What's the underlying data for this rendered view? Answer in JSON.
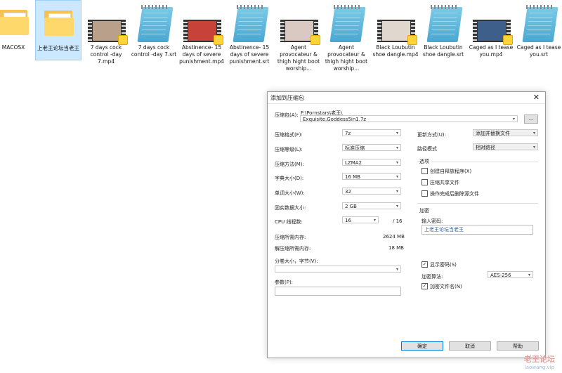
{
  "desktop": {
    "files": [
      {
        "name": "MACOSX",
        "kind": "folder"
      },
      {
        "name": "上老王论坛当老王",
        "kind": "folder",
        "selected": true
      },
      {
        "name": "7 days cock control -day 7.mp4",
        "kind": "video",
        "thumb": "#b9a08a"
      },
      {
        "name": "7 days cock control -day 7.srt",
        "kind": "notepad"
      },
      {
        "name": "Abstinence- 15 days of severe punishment.mp4",
        "kind": "video",
        "thumb": "#c7433a"
      },
      {
        "name": "Abstinence- 15 days of severe punishment.srt",
        "kind": "notepad"
      },
      {
        "name": "Agent provocateur & thigh hight boot worship...",
        "kind": "video",
        "thumb": "#d9c9c2"
      },
      {
        "name": "Agent provocateur & thigh hight boot worship...",
        "kind": "notepad"
      },
      {
        "name": "Black Loubutin shoe dangle.mp4",
        "kind": "video",
        "thumb": "#e0d7cf"
      },
      {
        "name": "Black Loubutin shoe dangle.srt",
        "kind": "notepad"
      },
      {
        "name": "Caged as I tease you.mp4",
        "kind": "video",
        "thumb": "#3d5f8a"
      },
      {
        "name": "Caged as I tease you.srt",
        "kind": "notepad"
      }
    ]
  },
  "dialog": {
    "title": "添加到压缩包",
    "close": "✕",
    "archive_label": "压缩包(A):",
    "archive_dir": "F:\\Pornstars\\老王\\",
    "archive_name": "Exquisite.Goddess5in1.7z",
    "browse": "...",
    "format_label": "压缩格式(F):",
    "format_value": "7z",
    "level_label": "压缩等级(L):",
    "level_value": "标准压缩",
    "method_label": "压缩方法(M):",
    "method_value": "LZMA2",
    "dict_label": "字典大小(D):",
    "dict_value": "16 MB",
    "word_label": "单词大小(W):",
    "word_value": "32",
    "solid_label": "固实数据大小:",
    "solid_value": "2 GB",
    "cpu_label": "CPU 线程数:",
    "cpu_value": "16",
    "cpu_total": "/ 16",
    "mem_comp_label": "压缩所需内存:",
    "mem_comp_value": "2624 MB",
    "mem_decomp_label": "解压缩所需内存:",
    "mem_decomp_value": "18 MB",
    "split_label": "分卷大小，字节(V):",
    "params_label": "参数(P):",
    "update_label": "更新方式(U):",
    "update_value": "添加并替换文件",
    "path_label": "路径模式",
    "path_value": "相对路径",
    "options_title": "选项",
    "opt_sfx": "创建自释放程序(X)",
    "opt_shared": "压缩共享文件",
    "opt_delete": "操作完成后删除源文件",
    "encrypt_title": "加密",
    "password_label": "输入密码:",
    "password_value": "上老王论坛当老王",
    "show_password": "显示密码(S)",
    "enc_method_label": "加密算法:",
    "enc_method_value": "AES-256",
    "enc_names": "加密文件名(N)",
    "ok": "确定",
    "cancel": "取消",
    "help": "帮助",
    "check_mark": "✓"
  },
  "watermark": {
    "title": "老王论坛",
    "url": "laowang.vip"
  }
}
